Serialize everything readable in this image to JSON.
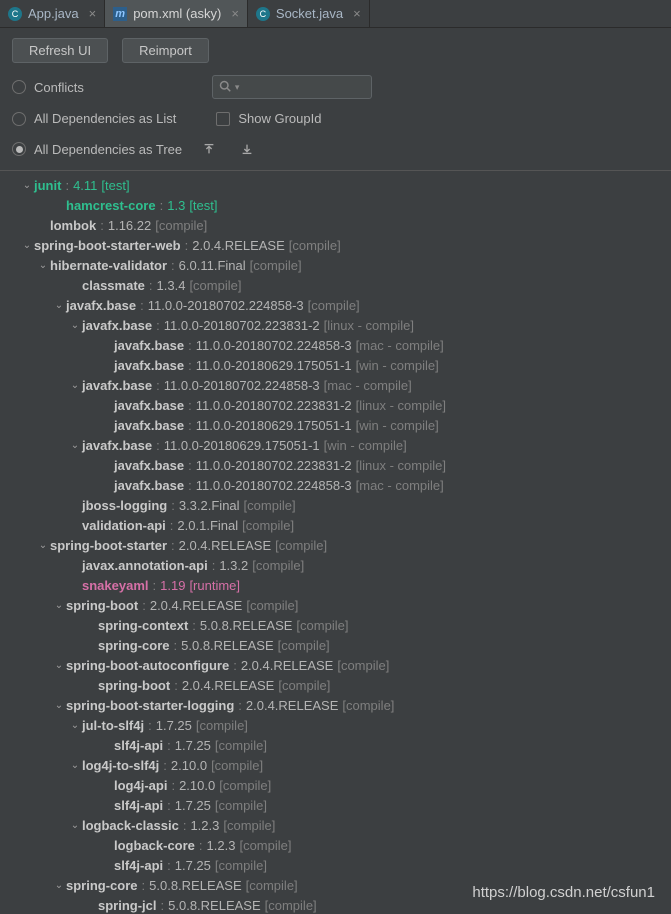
{
  "tabs": [
    {
      "label": "App.java",
      "icon": "c"
    },
    {
      "label": "pom.xml (asky)",
      "icon": "m",
      "active": true
    },
    {
      "label": "Socket.java",
      "icon": "c"
    }
  ],
  "toolbar": {
    "refresh_label": "Refresh UI",
    "reimport_label": "Reimport"
  },
  "options": {
    "conflicts_label": "Conflicts",
    "all_list_label": "All Dependencies as List",
    "all_tree_label": "All Dependencies as Tree",
    "show_groupid_label": "Show GroupId",
    "search_placeholder": ""
  },
  "watermark": "https://blog.csdn.net/csfun1",
  "tree": [
    {
      "d": 1,
      "c": "open",
      "n": "junit",
      "v": "4.11",
      "s": "[test]",
      "cls": "green"
    },
    {
      "d": 3,
      "n": "hamcrest-core",
      "v": "1.3",
      "s": "[test]",
      "cls": "green"
    },
    {
      "d": 2,
      "n": "lombok",
      "v": "1.16.22",
      "s": "[compile]",
      "cls": "bold"
    },
    {
      "d": 1,
      "c": "open",
      "n": "spring-boot-starter-web",
      "v": "2.0.4.RELEASE",
      "s": "[compile]",
      "cls": "bold"
    },
    {
      "d": 2,
      "c": "open",
      "n": "hibernate-validator",
      "v": "6.0.11.Final",
      "s": "[compile]",
      "cls": "bold"
    },
    {
      "d": 4,
      "n": "classmate",
      "v": "1.3.4",
      "s": "[compile]",
      "cls": "bold"
    },
    {
      "d": 3,
      "c": "open",
      "n": "javafx.base",
      "v": "11.0.0-20180702.224858-3",
      "s": "[compile]",
      "cls": "bold"
    },
    {
      "d": 4,
      "c": "open",
      "n": "javafx.base",
      "v": "11.0.0-20180702.223831-2",
      "s": "[linux - compile]",
      "cls": "bold"
    },
    {
      "d": 6,
      "n": "javafx.base",
      "v": "11.0.0-20180702.224858-3",
      "s": "[mac - compile]",
      "cls": "bold"
    },
    {
      "d": 6,
      "n": "javafx.base",
      "v": "11.0.0-20180629.175051-1",
      "s": "[win - compile]",
      "cls": "bold"
    },
    {
      "d": 4,
      "c": "open",
      "n": "javafx.base",
      "v": "11.0.0-20180702.224858-3",
      "s": "[mac - compile]",
      "cls": "bold"
    },
    {
      "d": 6,
      "n": "javafx.base",
      "v": "11.0.0-20180702.223831-2",
      "s": "[linux - compile]",
      "cls": "bold"
    },
    {
      "d": 6,
      "n": "javafx.base",
      "v": "11.0.0-20180629.175051-1",
      "s": "[win - compile]",
      "cls": "bold"
    },
    {
      "d": 4,
      "c": "open",
      "n": "javafx.base",
      "v": "11.0.0-20180629.175051-1",
      "s": "[win - compile]",
      "cls": "bold"
    },
    {
      "d": 6,
      "n": "javafx.base",
      "v": "11.0.0-20180702.223831-2",
      "s": "[linux - compile]",
      "cls": "bold"
    },
    {
      "d": 6,
      "n": "javafx.base",
      "v": "11.0.0-20180702.224858-3",
      "s": "[mac - compile]",
      "cls": "bold"
    },
    {
      "d": 4,
      "n": "jboss-logging",
      "v": "3.3.2.Final",
      "s": "[compile]",
      "cls": "bold"
    },
    {
      "d": 4,
      "n": "validation-api",
      "v": "2.0.1.Final",
      "s": "[compile]",
      "cls": "bold"
    },
    {
      "d": 2,
      "c": "open",
      "n": "spring-boot-starter",
      "v": "2.0.4.RELEASE",
      "s": "[compile]",
      "cls": "bold"
    },
    {
      "d": 4,
      "n": "javax.annotation-api",
      "v": "1.3.2",
      "s": "[compile]",
      "cls": "bold"
    },
    {
      "d": 4,
      "n": "snakeyaml",
      "v": "1.19",
      "s": "[runtime]",
      "cls": "magenta"
    },
    {
      "d": 3,
      "c": "open",
      "n": "spring-boot",
      "v": "2.0.4.RELEASE",
      "s": "[compile]",
      "cls": "bold"
    },
    {
      "d": 5,
      "n": "spring-context",
      "v": "5.0.8.RELEASE",
      "s": "[compile]",
      "cls": "bold"
    },
    {
      "d": 5,
      "n": "spring-core",
      "v": "5.0.8.RELEASE",
      "s": "[compile]",
      "cls": "bold"
    },
    {
      "d": 3,
      "c": "open",
      "n": "spring-boot-autoconfigure",
      "v": "2.0.4.RELEASE",
      "s": "[compile]",
      "cls": "bold"
    },
    {
      "d": 5,
      "n": "spring-boot",
      "v": "2.0.4.RELEASE",
      "s": "[compile]",
      "cls": "bold"
    },
    {
      "d": 3,
      "c": "open",
      "n": "spring-boot-starter-logging",
      "v": "2.0.4.RELEASE",
      "s": "[compile]",
      "cls": "bold"
    },
    {
      "d": 4,
      "c": "open",
      "n": "jul-to-slf4j",
      "v": "1.7.25",
      "s": "[compile]",
      "cls": "bold"
    },
    {
      "d": 6,
      "n": "slf4j-api",
      "v": "1.7.25",
      "s": "[compile]",
      "cls": "bold"
    },
    {
      "d": 4,
      "c": "open",
      "n": "log4j-to-slf4j",
      "v": "2.10.0",
      "s": "[compile]",
      "cls": "bold"
    },
    {
      "d": 6,
      "n": "log4j-api",
      "v": "2.10.0",
      "s": "[compile]",
      "cls": "bold"
    },
    {
      "d": 6,
      "n": "slf4j-api",
      "v": "1.7.25",
      "s": "[compile]",
      "cls": "bold"
    },
    {
      "d": 4,
      "c": "open",
      "n": "logback-classic",
      "v": "1.2.3",
      "s": "[compile]",
      "cls": "bold"
    },
    {
      "d": 6,
      "n": "logback-core",
      "v": "1.2.3",
      "s": "[compile]",
      "cls": "bold"
    },
    {
      "d": 6,
      "n": "slf4j-api",
      "v": "1.7.25",
      "s": "[compile]",
      "cls": "bold"
    },
    {
      "d": 3,
      "c": "open",
      "n": "spring-core",
      "v": "5.0.8.RELEASE",
      "s": "[compile]",
      "cls": "bold"
    },
    {
      "d": 5,
      "n": "spring-jcl",
      "v": "5.0.8.RELEASE",
      "s": "[compile]",
      "cls": "bold"
    }
  ],
  "chart_data": null
}
